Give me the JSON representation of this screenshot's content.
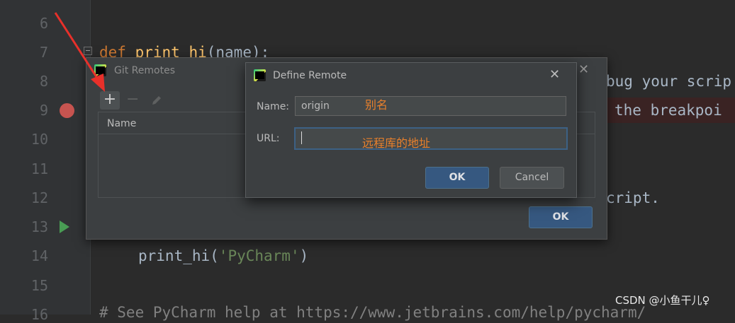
{
  "editor": {
    "line_numbers": [
      "6",
      "7",
      "8",
      "9",
      "10",
      "11",
      "12",
      "13",
      "14",
      "15",
      "16"
    ],
    "line7": {
      "kw": "def",
      "fn": "print_hi",
      "rest": "(name):"
    },
    "line8_tail": "bug your scrip",
    "line9_tail": "the breakpoi",
    "line12_tail": "cript.",
    "line14": {
      "call": "print_hi(",
      "arg": "'PyCharm'",
      "close": ")"
    },
    "line16": "# See PyCharm help at https://www.jetbrains.com/help/pycharm/"
  },
  "git_remotes_dialog": {
    "title": "Git Remotes",
    "add_icon": "+",
    "remove_icon": "−",
    "table_header": "Name",
    "ok_label": "OK"
  },
  "define_remote_dialog": {
    "title": "Define Remote",
    "close_icon": "✕",
    "name_label": "Name:",
    "name_value": "origin",
    "url_label": "URL:",
    "url_value": "",
    "ok_label": "OK",
    "cancel_label": "Cancel"
  },
  "annotations": {
    "name_note": "别名",
    "url_note": "远程库的地址"
  },
  "watermark": "CSDN @小鱼干儿♀",
  "colors": {
    "accent": "#365880",
    "breakpoint": "#c75450",
    "arrow": "#e8302a",
    "annotation": "#e8802c"
  }
}
